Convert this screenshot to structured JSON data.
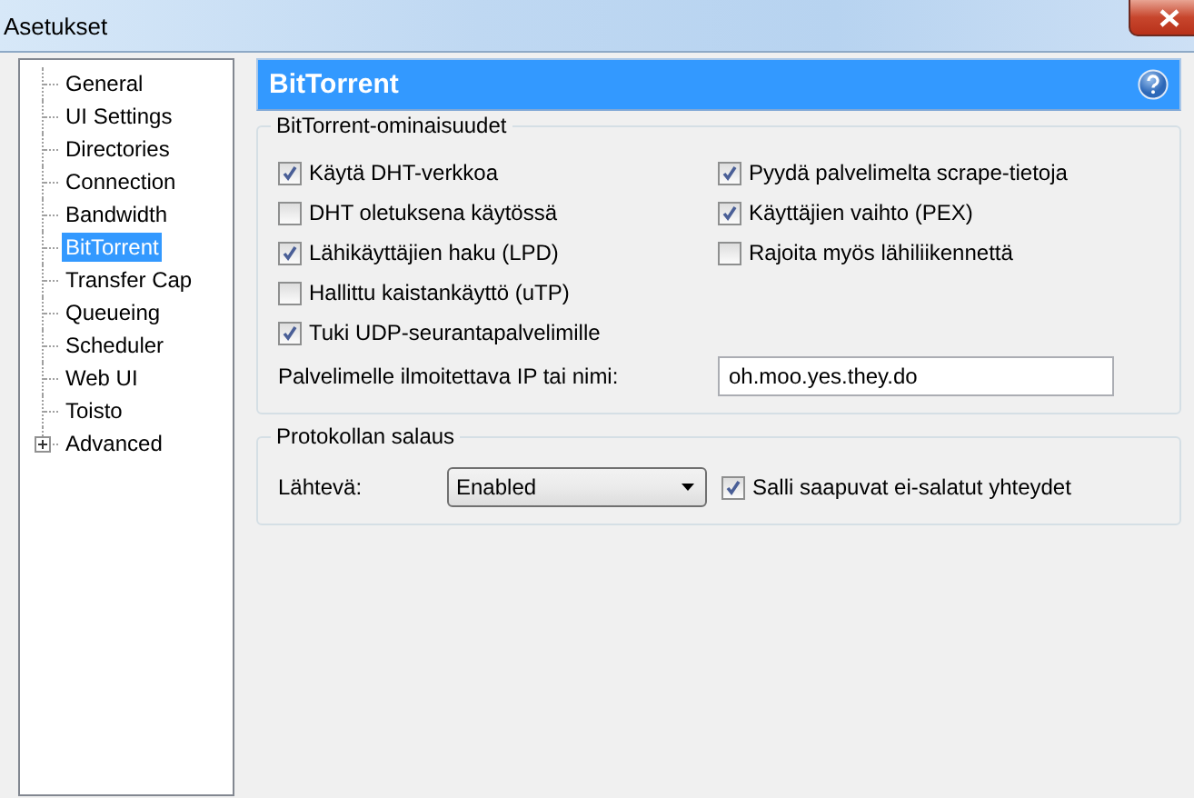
{
  "window": {
    "title": "Asetukset"
  },
  "sidebar": {
    "items": [
      {
        "label": "General",
        "selected": false
      },
      {
        "label": "UI Settings",
        "selected": false
      },
      {
        "label": "Directories",
        "selected": false
      },
      {
        "label": "Connection",
        "selected": false
      },
      {
        "label": "Bandwidth",
        "selected": false
      },
      {
        "label": "BitTorrent",
        "selected": true
      },
      {
        "label": "Transfer Cap",
        "selected": false
      },
      {
        "label": "Queueing",
        "selected": false
      },
      {
        "label": "Scheduler",
        "selected": false
      },
      {
        "label": "Web UI",
        "selected": false
      },
      {
        "label": "Toisto",
        "selected": false
      },
      {
        "label": "Advanced",
        "selected": false,
        "expanded": false
      }
    ]
  },
  "header": {
    "title": "BitTorrent"
  },
  "features": {
    "title": "BitTorrent-ominaisuudet",
    "left": [
      {
        "label": "Käytä DHT-verkkoa",
        "checked": true
      },
      {
        "label": "DHT oletuksena käytössä",
        "checked": false
      },
      {
        "label": "Lähikäyttäjien haku (LPD)",
        "checked": true
      },
      {
        "label": "Hallittu kaistankäyttö (uTP)",
        "checked": false
      },
      {
        "label": "Tuki UDP-seurantapalvelimille",
        "checked": true
      }
    ],
    "right": [
      {
        "label": "Pyydä palvelimelta scrape-tietoja",
        "checked": true
      },
      {
        "label": "Käyttäjien vaihto (PEX)",
        "checked": true
      },
      {
        "label": "Rajoita myös lähiliikennettä",
        "checked": false
      }
    ],
    "ip_label": "Palvelimelle ilmoitettava IP tai nimi:",
    "ip_value": "oh.moo.yes.they.do"
  },
  "encryption": {
    "title": "Protokollan salaus",
    "outgoing_label": "Lähtevä:",
    "outgoing_value": "Enabled",
    "allow_incoming": {
      "label": "Salli saapuvat ei-salatut yhteydet",
      "checked": true
    }
  }
}
